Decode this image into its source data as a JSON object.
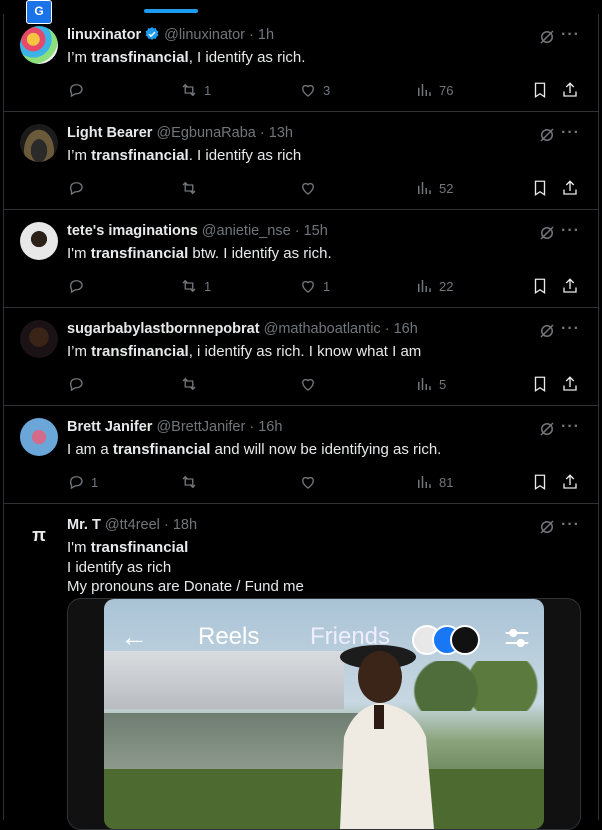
{
  "topbar": {
    "translate_badge": "G"
  },
  "tweets": [
    {
      "name": "linuxinator",
      "handle": "@linuxinator",
      "time": "1h",
      "verified": true,
      "pre": "I’m ",
      "bold": "transfinancial",
      "post": ", I identify as rich.",
      "replies": "",
      "retweets": "1",
      "likes": "3",
      "views": "76"
    },
    {
      "name": "Light Bearer",
      "handle": "@EgbunaRaba",
      "time": "13h",
      "verified": false,
      "pre": "I’m ",
      "bold": "transfinancial",
      "post": ". I identify as rich",
      "replies": "",
      "retweets": "",
      "likes": "",
      "views": "52"
    },
    {
      "name": "tete's imaginations",
      "handle": "@anietie_nse",
      "time": "15h",
      "verified": false,
      "pre": "I'm ",
      "bold": "transfinancial",
      "post": "  btw. I identify as rich.",
      "replies": "",
      "retweets": "1",
      "likes": "1",
      "views": "22"
    },
    {
      "name": "sugarbabylastbornnepobrat",
      "handle": "@mathaboatlantic",
      "time": "16h",
      "verified": false,
      "pre": "I’m ",
      "bold": "transfinancial",
      "post": ", i identify as rich. I know what I am",
      "replies": "",
      "retweets": "",
      "likes": "",
      "views": "5"
    },
    {
      "name": "Brett Janifer",
      "handle": "@BrettJanifer",
      "time": "16h",
      "verified": false,
      "pre": "I am a ",
      "bold": "transfinancial",
      "post": " and will now be identifying as rich.",
      "replies": "1",
      "retweets": "",
      "likes": "",
      "views": "81"
    }
  ],
  "last_tweet": {
    "name": "Mr. T",
    "handle": "@tt4reel",
    "time": "18h",
    "line1_pre": "I'm ",
    "line1_bold": "transfinancial",
    "line2": "I identify as rich",
    "line3": "My pronouns are Donate / Fund me",
    "media": {
      "back": "←",
      "reels": "Reels",
      "friends": "Friends"
    }
  },
  "separator": "·",
  "icons": {
    "grok": "grok-icon",
    "more": "more-icon",
    "reply": "reply-icon",
    "retweet": "retweet-icon",
    "like": "like-icon",
    "views": "views-icon",
    "bookmark": "bookmark-icon",
    "share": "share-icon"
  },
  "colors": {
    "bg": "#000000",
    "text": "#e7e9ea",
    "muted": "#71767b",
    "accent": "#1d9bf0",
    "border": "#2f3336"
  }
}
